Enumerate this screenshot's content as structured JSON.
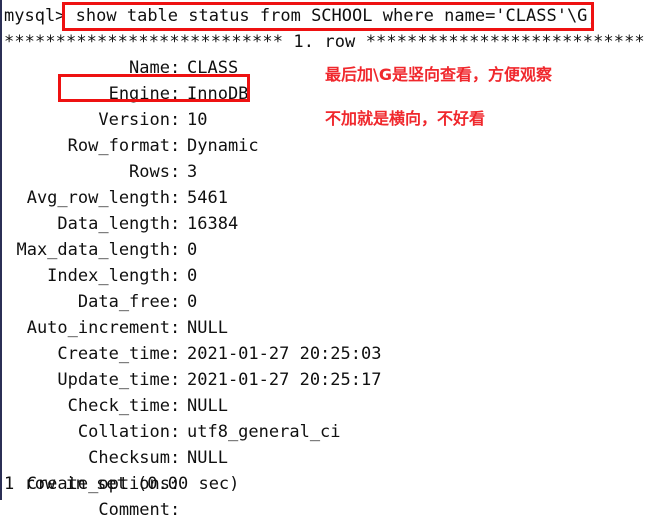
{
  "terminal": {
    "prompt": "mysql>",
    "command": "show table status from SCHOOL where name='CLASS'\\G;",
    "separator": "*************************** 1. row ***************************",
    "footer": "1 row in set (0.00 sec)",
    "text_color": "#101010",
    "background_color": "#ffffff"
  },
  "result": {
    "fields": [
      {
        "key": "Name",
        "colon": ":",
        "value": "CLASS"
      },
      {
        "key": "Engine",
        "colon": ":",
        "value": "InnoDB"
      },
      {
        "key": "Version",
        "colon": ":",
        "value": "10"
      },
      {
        "key": "Row_format",
        "colon": ":",
        "value": "Dynamic"
      },
      {
        "key": "Rows",
        "colon": ":",
        "value": "3"
      },
      {
        "key": "Avg_row_length",
        "colon": ":",
        "value": "5461"
      },
      {
        "key": "Data_length",
        "colon": ":",
        "value": "16384"
      },
      {
        "key": "Max_data_length",
        "colon": ":",
        "value": "0"
      },
      {
        "key": "Index_length",
        "colon": ":",
        "value": "0"
      },
      {
        "key": "Data_free",
        "colon": ":",
        "value": "0"
      },
      {
        "key": "Auto_increment",
        "colon": ":",
        "value": "NULL"
      },
      {
        "key": "Create_time",
        "colon": ":",
        "value": "2021-01-27 20:25:03"
      },
      {
        "key": "Update_time",
        "colon": ":",
        "value": "2021-01-27 20:25:17"
      },
      {
        "key": "Check_time",
        "colon": ":",
        "value": "NULL"
      },
      {
        "key": "Collation",
        "colon": ":",
        "value": "utf8_general_ci"
      },
      {
        "key": "Checksum",
        "colon": ":",
        "value": "NULL"
      },
      {
        "key": "Create_options",
        "colon": ":",
        "value": ""
      },
      {
        "key": "Comment",
        "colon": ":",
        "value": ""
      }
    ]
  },
  "annotations": {
    "color": "#f0282d",
    "notes": [
      {
        "text": "最后加\\G是竖向查看，方便观察"
      },
      {
        "text": "不加就是横向，不好看"
      }
    ],
    "highlight_command_label": "highlight around full SHOW TABLE STATUS command",
    "highlight_engine_label": "highlight around Engine: InnoDB row"
  }
}
